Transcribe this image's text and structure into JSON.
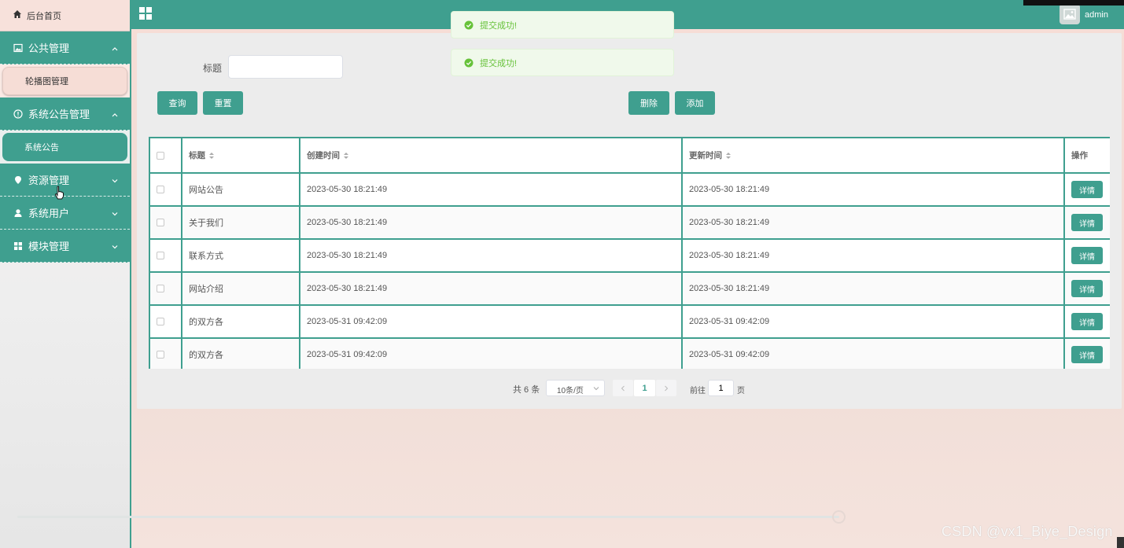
{
  "colors": {
    "accent": "#3f9f8f",
    "success": "#67c23a"
  },
  "sidebar": {
    "home": {
      "label": "后台首页",
      "icon": "home-icon"
    },
    "groups": [
      {
        "label": "公共管理",
        "icon": "image-icon",
        "expanded": true,
        "children": [
          {
            "label": "轮播图管理",
            "active": false
          }
        ]
      },
      {
        "label": "系统公告管理",
        "icon": "info-icon",
        "expanded": true,
        "children": [
          {
            "label": "系统公告",
            "active": true
          }
        ]
      },
      {
        "label": "资源管理",
        "icon": "location-icon",
        "expanded": false
      },
      {
        "label": "系统用户",
        "icon": "user-icon",
        "expanded": false
      },
      {
        "label": "模块管理",
        "icon": "grid-icon",
        "expanded": false
      }
    ]
  },
  "header": {
    "menu_icon": "grid-menu-icon",
    "user": "admin",
    "avatar_icon": "image-placeholder-icon"
  },
  "toasts": [
    "提交成功!",
    "提交成功!"
  ],
  "search": {
    "label": "标题",
    "value": "",
    "placeholder": ""
  },
  "buttons": {
    "query": "查询",
    "reset": "重置",
    "delete": "删除",
    "add": "添加"
  },
  "table": {
    "columns": {
      "title": "标题",
      "created": "创建时间",
      "updated": "更新时间",
      "action": "操作"
    },
    "action_label": "详情",
    "rows": [
      {
        "title": "网站公告",
        "created": "2023-05-30 18:21:49",
        "updated": "2023-05-30 18:21:49"
      },
      {
        "title": "关于我们",
        "created": "2023-05-30 18:21:49",
        "updated": "2023-05-30 18:21:49"
      },
      {
        "title": "联系方式",
        "created": "2023-05-30 18:21:49",
        "updated": "2023-05-30 18:21:49"
      },
      {
        "title": "网站介绍",
        "created": "2023-05-30 18:21:49",
        "updated": "2023-05-30 18:21:49"
      },
      {
        "title": "的双方各",
        "created": "2023-05-31 09:42:09",
        "updated": "2023-05-31 09:42:09"
      },
      {
        "title": "的双方各",
        "created": "2023-05-31 09:42:09",
        "updated": "2023-05-31 09:42:09"
      }
    ]
  },
  "pagination": {
    "total": "共 6 条",
    "page_size": "10条/页",
    "current": "1",
    "goto_label": "前往",
    "goto_value": "1",
    "page_label": "页"
  },
  "watermark": "CSDN @vx1_Biye_Design"
}
